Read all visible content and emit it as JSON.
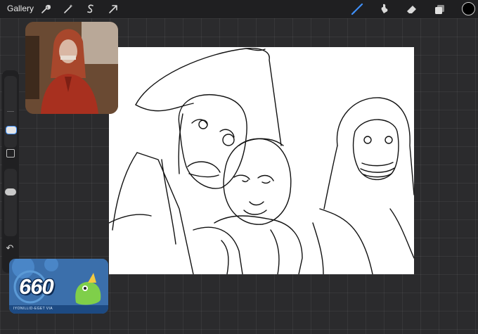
{
  "topbar": {
    "gallery_label": "Gallery",
    "left_tools": [
      {
        "name": "actions-wrench-icon"
      },
      {
        "name": "adjustments-wand-icon"
      },
      {
        "name": "selection-s-icon"
      },
      {
        "name": "transform-arrow-icon"
      }
    ],
    "right_tools": [
      {
        "name": "brush-icon",
        "active": true
      },
      {
        "name": "smudge-icon"
      },
      {
        "name": "eraser-icon"
      },
      {
        "name": "layers-icon"
      }
    ],
    "current_color": "#000000",
    "active_color": "#3f8ff7"
  },
  "sidebar": {
    "brush_size_slider": "size",
    "opacity_slider": "opacity",
    "modify_button": "modify",
    "undo_icon": "↶"
  },
  "reference": {
    "type": "reference-photo",
    "description_hidden": true
  },
  "badge": {
    "number": "660",
    "caption": "IYONILLID-EGET VIA"
  }
}
